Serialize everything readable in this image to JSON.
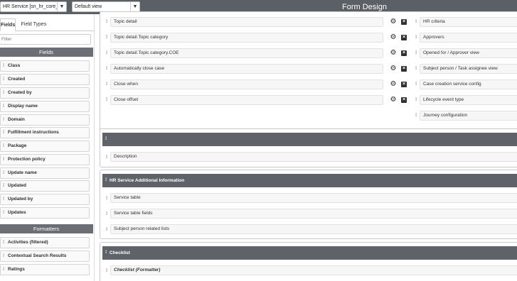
{
  "toolbar": {
    "table_select": "HR Service [sn_hr_core_se",
    "view_select": "Default view",
    "title": "Form Design"
  },
  "left_panel": {
    "tabs": [
      "Fields",
      "Field Types"
    ],
    "filter_placeholder": "Filter",
    "fields_header": "Fields",
    "fields": [
      "Class",
      "Created",
      "Created by",
      "Display name",
      "Domain",
      "Fulfillment instructions",
      "Package",
      "Protection policy",
      "Update name",
      "Updated",
      "Updated by",
      "Updates"
    ],
    "formatters_header": "Formatters",
    "formatters": [
      "Activities (filtered)",
      "Contextual Search Results",
      "Ratings"
    ]
  },
  "form": {
    "section1": {
      "left_fields": [
        "Topic detail",
        "Topic detail.Topic category",
        "Topic detail.Topic category.COE",
        "Automatically close case",
        "Close when",
        "Close offset"
      ],
      "right_fields": [
        "HR criteria",
        "Approvers",
        "Opened for / Approver view",
        "Subject person / Task assignee view",
        "Case creation service config",
        "Lifecycle event type",
        "Journey configuration"
      ]
    },
    "section2": {
      "title": "",
      "fields": [
        "Description"
      ]
    },
    "section3": {
      "title": "HR Service Additional Information",
      "fields": [
        "Service table",
        "Service table fields",
        "Subject person related lists"
      ]
    },
    "section4": {
      "title": "Checklist",
      "fields": [
        "Checklist (Formatter)"
      ]
    }
  },
  "icons": {
    "gear": "gear-icon",
    "remove": "remove-icon",
    "grip": "drag-handle-icon",
    "caret": "chevron-down-icon"
  }
}
